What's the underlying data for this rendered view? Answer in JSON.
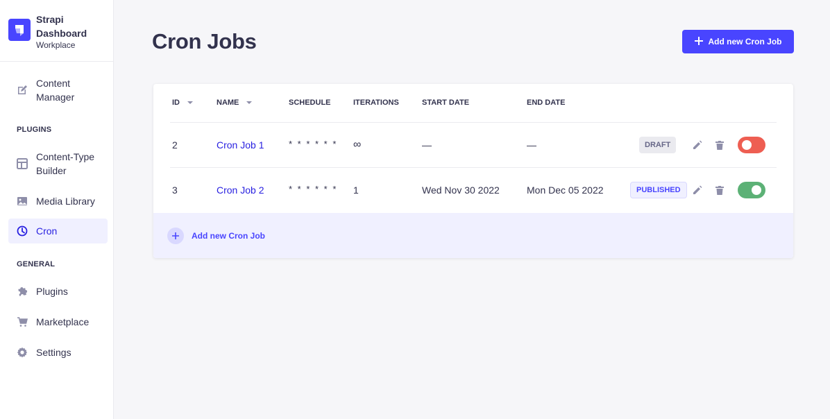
{
  "brand": {
    "title": "Strapi Dashboard",
    "subtitle": "Workplace",
    "logo_icon": "strapi-logo-icon",
    "accent": "#4945ff"
  },
  "sidebar": {
    "items": [
      {
        "label": "Content Manager",
        "icon": "pen-icon"
      },
      {
        "label": "Content-Type Builder",
        "icon": "layout-icon"
      },
      {
        "label": "Media Library",
        "icon": "image-icon"
      },
      {
        "label": "Cron",
        "icon": "clock-icon",
        "active": true
      },
      {
        "label": "Plugins",
        "icon": "puzzle-icon"
      },
      {
        "label": "Marketplace",
        "icon": "cart-icon"
      },
      {
        "label": "Settings",
        "icon": "gear-icon"
      }
    ],
    "sections": {
      "plugins": "PLUGINS",
      "general": "GENERAL"
    }
  },
  "header": {
    "title": "Cron Jobs",
    "add_button": "Add new Cron Job"
  },
  "table": {
    "columns": [
      "ID",
      "NAME",
      "SCHEDULE",
      "ITERATIONS",
      "START DATE",
      "END DATE"
    ],
    "rows": [
      {
        "id": "2",
        "name": "Cron Job 1",
        "schedule": "* * * * * *",
        "iterations": "∞",
        "start_date": "—",
        "end_date": "—",
        "status": "DRAFT",
        "enabled": false
      },
      {
        "id": "3",
        "name": "Cron Job 2",
        "schedule": "* * * * * *",
        "iterations": "1",
        "start_date": "Wed Nov 30 2022",
        "end_date": "Mon Dec 05 2022",
        "status": "PUBLISHED",
        "enabled": true
      }
    ],
    "add_row_label": "Add new Cron Job"
  },
  "colors": {
    "primary": "#4945ff",
    "toggle_off": "#ee5e52",
    "toggle_on": "#5cb176"
  }
}
